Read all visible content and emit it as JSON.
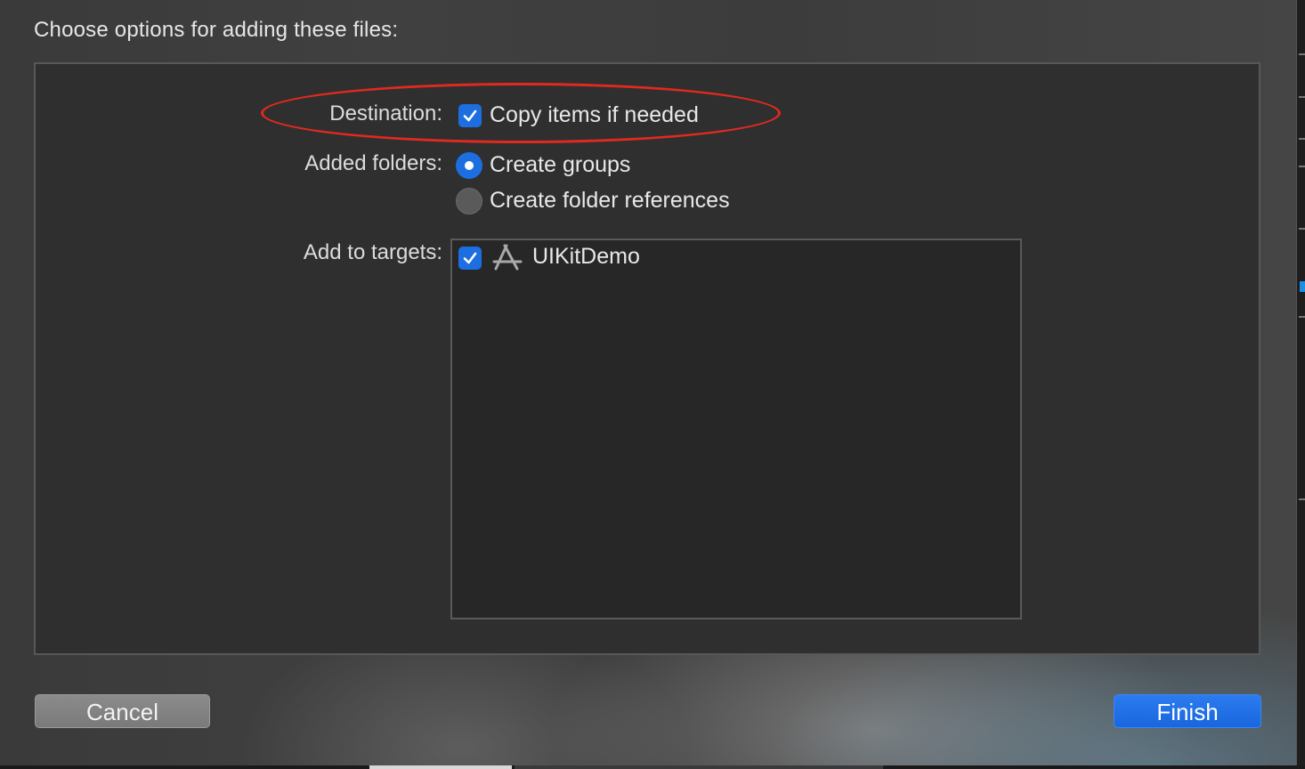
{
  "dialog": {
    "heading": "Choose options for adding these files:"
  },
  "destination": {
    "label": "Destination:",
    "checkbox_label": "Copy items if needed",
    "checked": true
  },
  "added_folders": {
    "label": "Added folders:",
    "options": [
      {
        "label": "Create groups",
        "selected": true
      },
      {
        "label": "Create folder references",
        "selected": false
      }
    ]
  },
  "targets": {
    "label": "Add to targets:",
    "items": [
      {
        "name": "UIKitDemo",
        "checked": true,
        "icon": "app-target-icon"
      }
    ]
  },
  "buttons": {
    "cancel": "Cancel",
    "finish": "Finish"
  },
  "colors": {
    "accent": "#1d6ee0",
    "annotation": "#e02a1f"
  }
}
